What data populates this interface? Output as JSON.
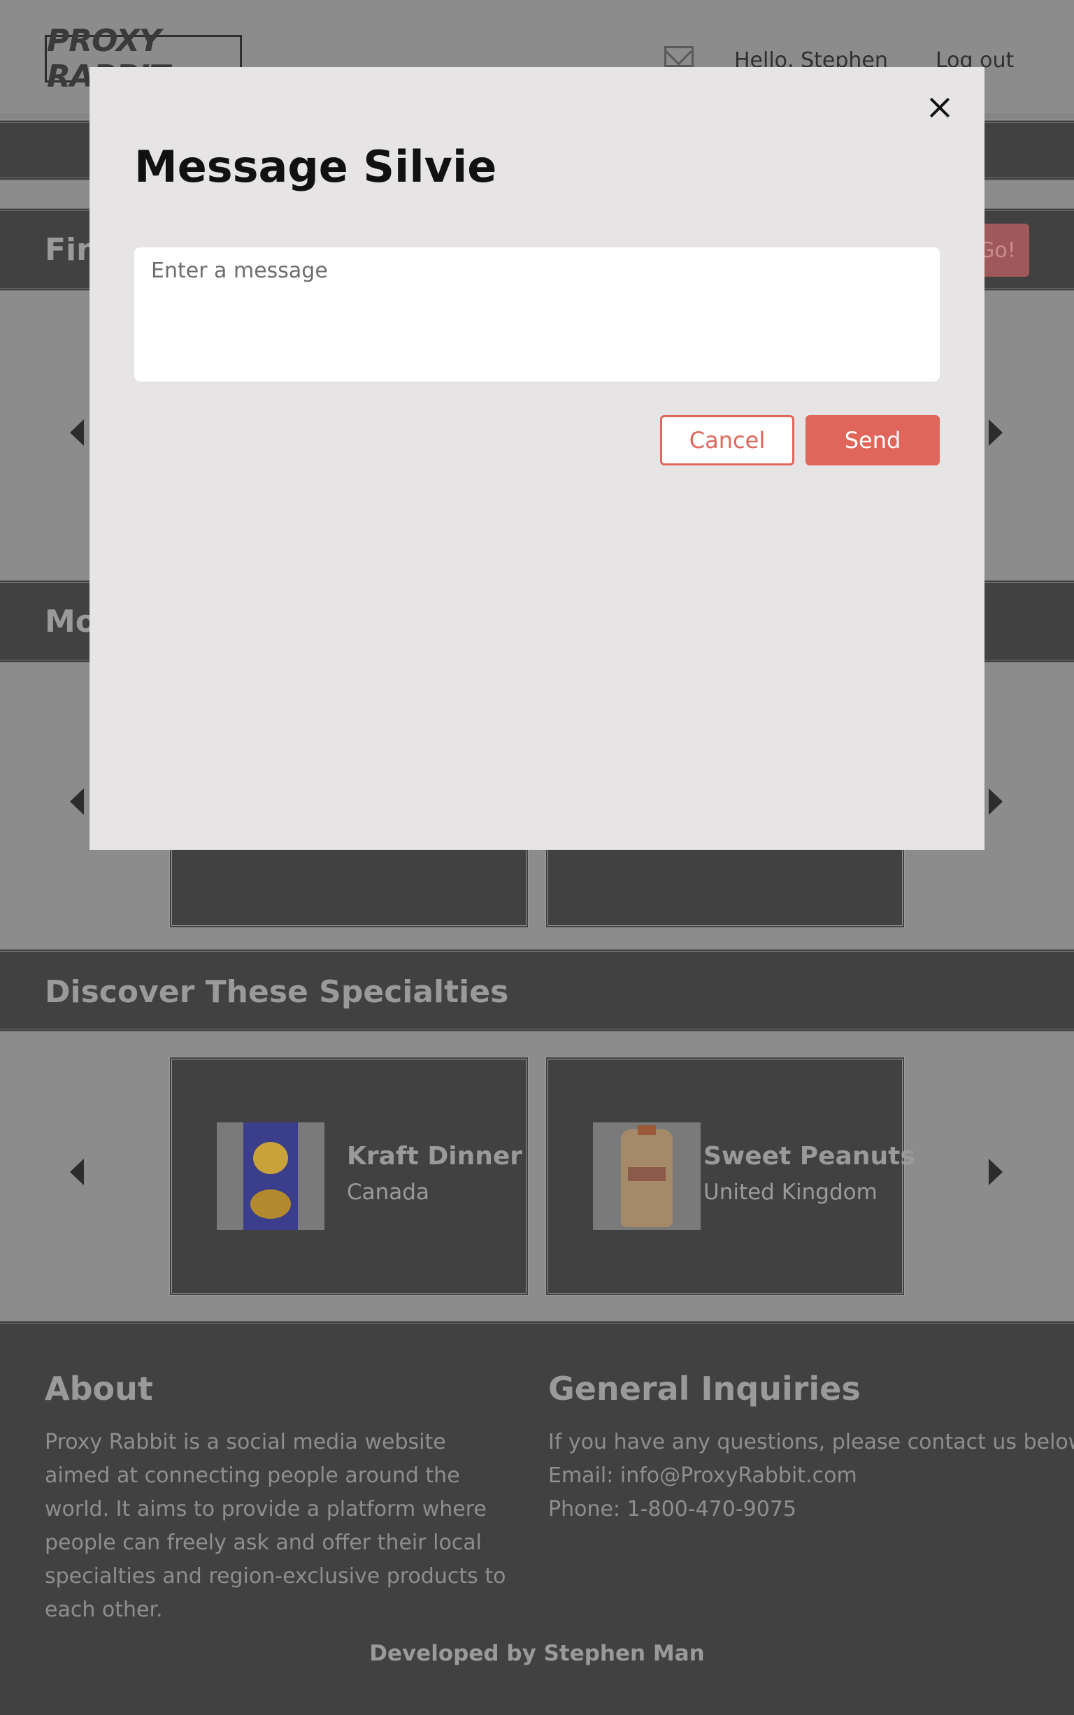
{
  "header": {
    "logo_text": "PROXY RABBIT",
    "greeting": "Hello, Stephen",
    "logout_label": "Log out",
    "mail_icon": "mail-icon"
  },
  "sections": {
    "find_title_partial": "Fin",
    "go_label": "Go!",
    "more_title_partial": "Mo",
    "discover_title": "Discover These Specialties"
  },
  "discover": {
    "items": [
      {
        "name": "Kraft Dinner",
        "country": "Canada"
      },
      {
        "name": "Sweet Peanuts",
        "country": "United Kingdom"
      }
    ]
  },
  "footer": {
    "about_title": "About",
    "about_text": "Proxy Rabbit is a social media website aimed at connecting people around the world. It aims to provide a platform where people can freely ask and offer their local specialties and region-exclusive products to each other.",
    "inquiries_title": "General Inquiries",
    "inquiries_line1": "If you have any questions, please contact us below:",
    "inquiries_email": "Email: info@ProxyRabbit.com",
    "inquiries_phone": "Phone: 1-800-470-9075",
    "developed_by": "Developed by Stephen Man"
  },
  "modal": {
    "title": "Message Silvie",
    "message_placeholder": "Enter a message",
    "message_value": "",
    "cancel_label": "Cancel",
    "send_label": "Send",
    "close_icon": "close-icon"
  },
  "colors": {
    "accent": "#e0665b",
    "overlay_bg": "#8c8c8c",
    "band_bg": "#414141",
    "modal_bg": "#e6e4e5"
  }
}
